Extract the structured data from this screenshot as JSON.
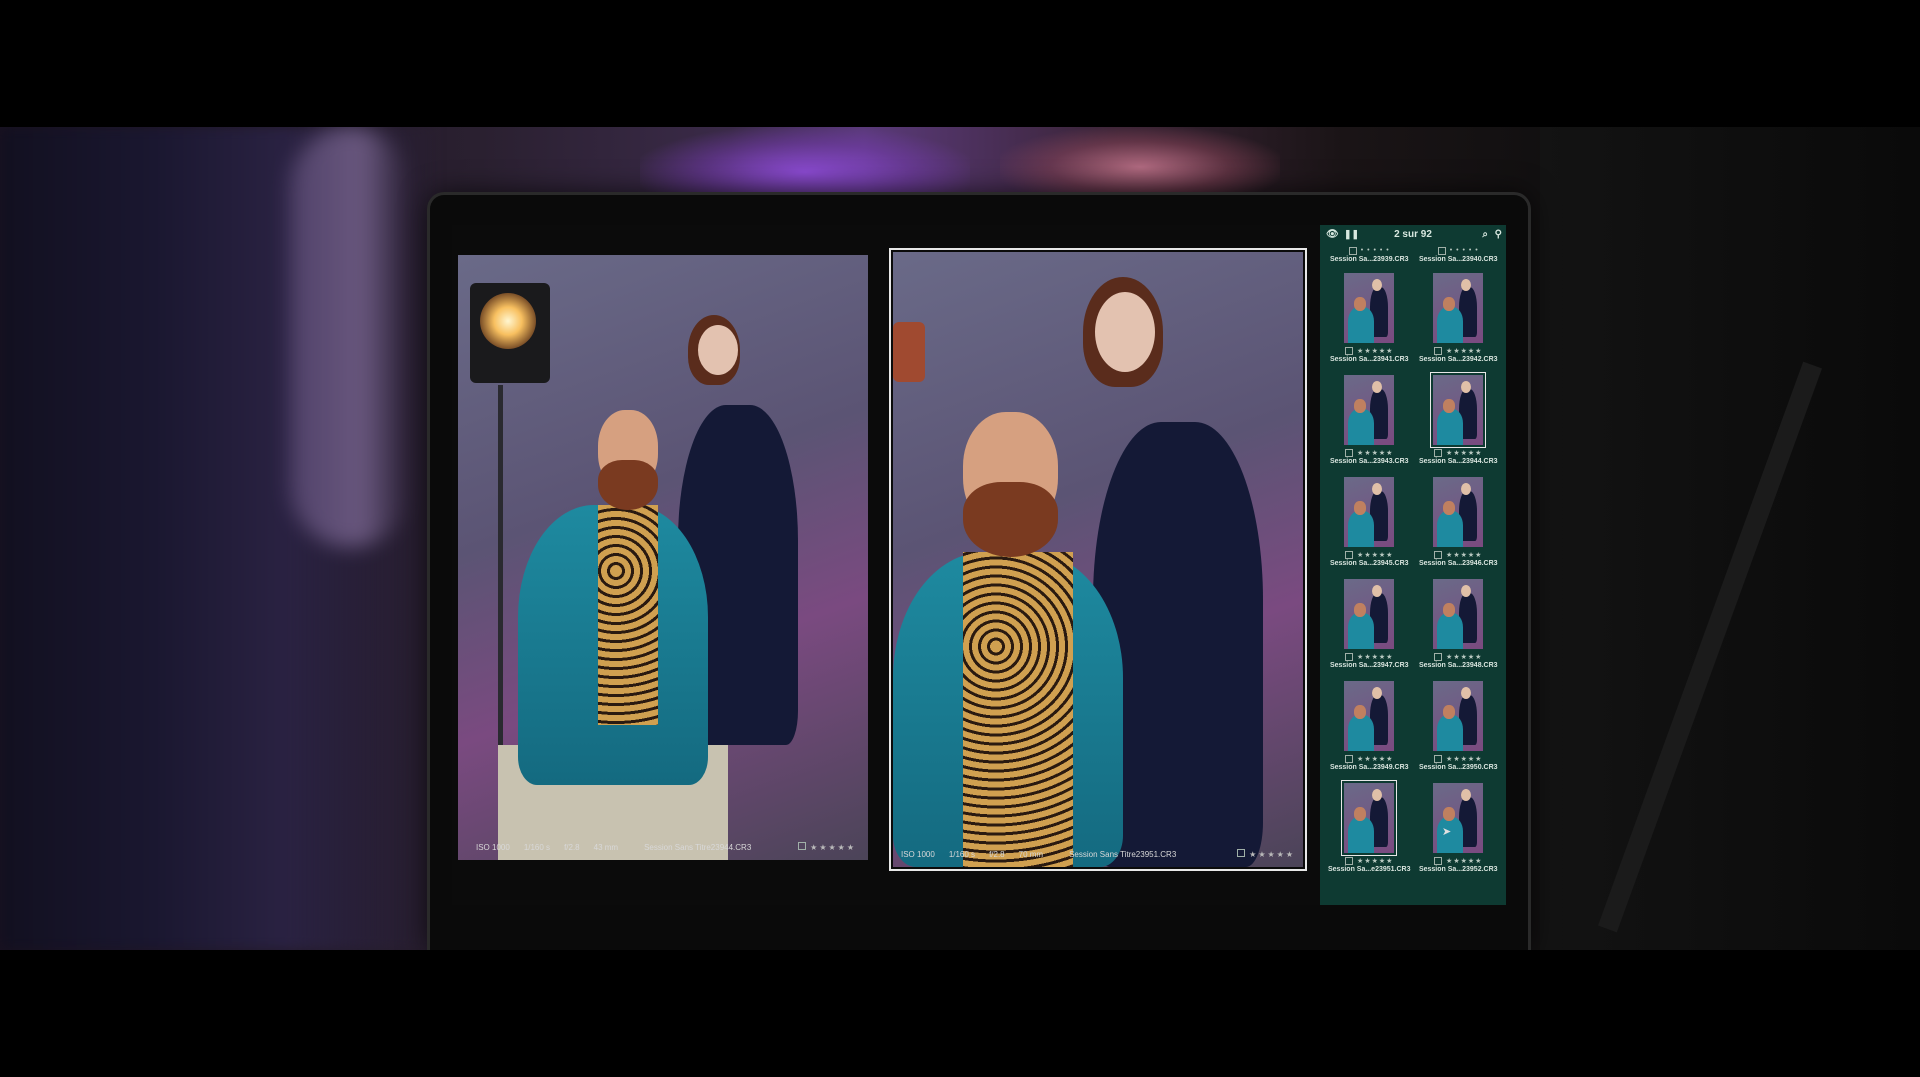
{
  "left_photo": {
    "iso": "ISO 1000",
    "shutter": "1/160 s",
    "aperture": "f/2.8",
    "focal": "43 mm",
    "filename": "Session Sans Titre23944.CR3",
    "stars": "★★★★★"
  },
  "right_photo": {
    "iso": "ISO 1000",
    "shutter": "1/160 s",
    "aperture": "f/2.8",
    "focal": "70 mm",
    "filename": "Session Sans Titre23951.CR3",
    "stars": "★★★★★"
  },
  "sidebar": {
    "counter": "2 sur 92",
    "top_files": [
      "Session Sa...23939.CR3",
      "Session Sa...23940.CR3"
    ],
    "thumbs": [
      {
        "name": "Session Sa...23941.CR3",
        "stars": "★★★★★",
        "selected": false
      },
      {
        "name": "Session Sa...23942.CR3",
        "stars": "★★★★★",
        "selected": false
      },
      {
        "name": "Session Sa...23943.CR3",
        "stars": "★★★★★",
        "selected": false
      },
      {
        "name": "Session Sa...23944.CR3",
        "stars": "★★★★★",
        "selected": true
      },
      {
        "name": "Session Sa...23945.CR3",
        "stars": "★★★★★",
        "selected": false
      },
      {
        "name": "Session Sa...23946.CR3",
        "stars": "★★★★★",
        "selected": false
      },
      {
        "name": "Session Sa...23947.CR3",
        "stars": "★★★★★",
        "selected": false
      },
      {
        "name": "Session Sa...23948.CR3",
        "stars": "★★★★★",
        "selected": false
      },
      {
        "name": "Session Sa...23949.CR3",
        "stars": "★★★★★",
        "selected": false
      },
      {
        "name": "Session Sa...23950.CR3",
        "stars": "★★★★★",
        "selected": false
      },
      {
        "name": "Session Sa...e23951.CR3",
        "stars": "★★★★★",
        "selected": true
      },
      {
        "name": "Session Sa...23952.CR3",
        "stars": "★★★★★",
        "selected": false
      }
    ]
  }
}
